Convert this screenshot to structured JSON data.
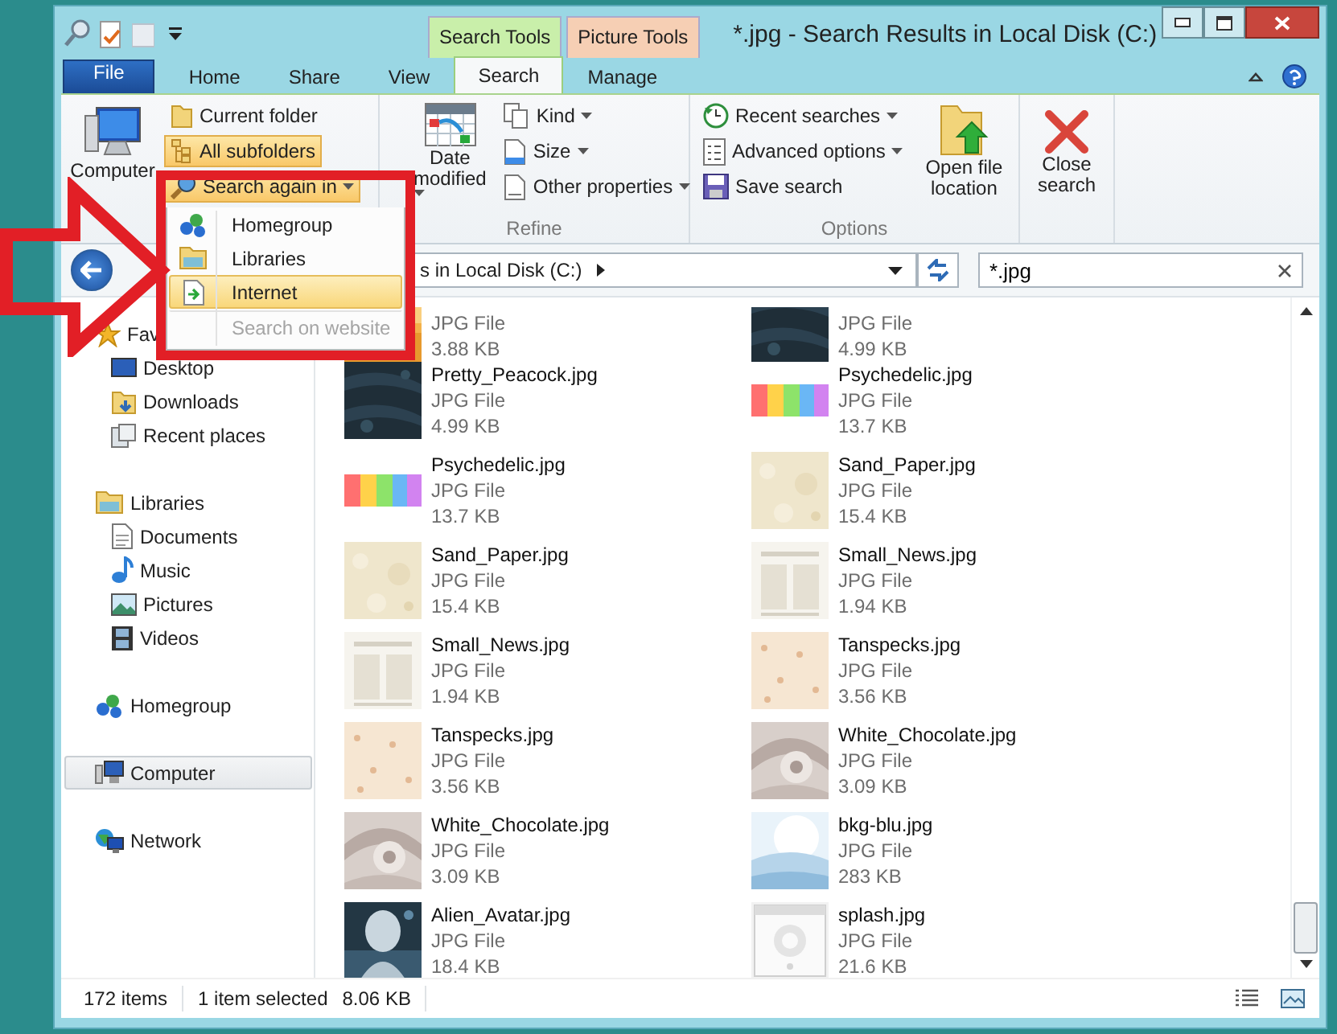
{
  "window": {
    "title": "*.jpg - Search Results in Local Disk (C:)"
  },
  "context_tabs": [
    {
      "label": "Search Tools",
      "color": "#c9efaa"
    },
    {
      "label": "Picture Tools",
      "color": "#f6cfb4"
    }
  ],
  "tabs": [
    {
      "label": "File",
      "kind": "file",
      "selected": false
    },
    {
      "label": "Home",
      "kind": "tab",
      "selected": false
    },
    {
      "label": "Share",
      "kind": "tab",
      "selected": false
    },
    {
      "label": "View",
      "kind": "tab",
      "selected": false
    },
    {
      "label": "Search",
      "kind": "tab",
      "selected": true
    },
    {
      "label": "Manage",
      "kind": "tab",
      "selected": false
    }
  ],
  "ribbon": {
    "computer": "Computer",
    "location_options": [
      {
        "label": "Current folder",
        "on": false,
        "dropdown": false
      },
      {
        "label": "All subfolders",
        "on": true,
        "dropdown": false
      },
      {
        "label": "Search again in",
        "on": true,
        "dropdown": true
      }
    ],
    "date_modified": "Date modified",
    "refine_options": [
      {
        "label": "Kind"
      },
      {
        "label": "Size"
      },
      {
        "label": "Other properties"
      }
    ],
    "refine_label": "Refine",
    "options": [
      {
        "label": "Recent searches",
        "dropdown": true
      },
      {
        "label": "Advanced options",
        "dropdown": true
      },
      {
        "label": "Save search",
        "dropdown": false
      }
    ],
    "open_file_location": "Open file location",
    "options_label": "Options",
    "close_search": "Close search"
  },
  "search_menu": [
    {
      "label": "Homegroup",
      "selected": false,
      "disabled": false
    },
    {
      "label": "Libraries",
      "selected": false,
      "disabled": false
    },
    {
      "label": "Internet",
      "selected": true,
      "disabled": false
    },
    {
      "label": "Search on website",
      "selected": false,
      "disabled": true
    }
  ],
  "address": {
    "path": "s in Local Disk (C:)"
  },
  "search_box": {
    "value": "*.jpg"
  },
  "navigation": [
    {
      "label": "Fav",
      "selected": false,
      "children": [
        {
          "label": "Desktop",
          "selected": false
        },
        {
          "label": "Downloads",
          "selected": false
        },
        {
          "label": "Recent places",
          "selected": false
        }
      ]
    },
    {
      "label": "Libraries",
      "selected": false,
      "children": [
        {
          "label": "Documents",
          "selected": false
        },
        {
          "label": "Music",
          "selected": false
        },
        {
          "label": "Pictures",
          "selected": false
        },
        {
          "label": "Videos",
          "selected": false
        }
      ]
    },
    {
      "label": "Homegroup",
      "selected": false
    },
    {
      "label": "Computer",
      "selected": true
    },
    {
      "label": "Network",
      "selected": false
    }
  ],
  "files": [
    {
      "type": "JPG File",
      "size": "3.88 KB"
    },
    {
      "type": "JPG File",
      "size": "4.99 KB"
    },
    {
      "name": "Pretty_Peacock.jpg",
      "type": "JPG File",
      "size": "4.99 KB"
    },
    {
      "name": "Psychedelic.jpg",
      "type": "JPG File",
      "size": "13.7 KB"
    },
    {
      "name": "Psychedelic.jpg",
      "type": "JPG File",
      "size": "13.7 KB"
    },
    {
      "name": "Sand_Paper.jpg",
      "type": "JPG File",
      "size": "15.4 KB"
    },
    {
      "name": "Sand_Paper.jpg",
      "type": "JPG File",
      "size": "15.4 KB"
    },
    {
      "name": "Small_News.jpg",
      "type": "JPG File",
      "size": "1.94 KB"
    },
    {
      "name": "Small_News.jpg",
      "type": "JPG File",
      "size": "1.94 KB"
    },
    {
      "name": "Tanspecks.jpg",
      "type": "JPG File",
      "size": "3.56 KB"
    },
    {
      "name": "Tanspecks.jpg",
      "type": "JPG File",
      "size": "3.56 KB"
    },
    {
      "name": "White_Chocolate.jpg",
      "type": "JPG File",
      "size": "3.09 KB"
    },
    {
      "name": "White_Chocolate.jpg",
      "type": "JPG File",
      "size": "3.09 KB"
    },
    {
      "name": "bkg-blu.jpg",
      "type": "JPG File",
      "size": "283 KB"
    },
    {
      "name": "Alien_Avatar.jpg",
      "type": "JPG File",
      "size": "18.4 KB"
    },
    {
      "name": "splash.jpg",
      "type": "JPG File",
      "size": "21.6 KB"
    }
  ],
  "status_bar": {
    "item_count": "172 items",
    "selection": "1 item selected",
    "selection_size": "8.06 KB"
  }
}
